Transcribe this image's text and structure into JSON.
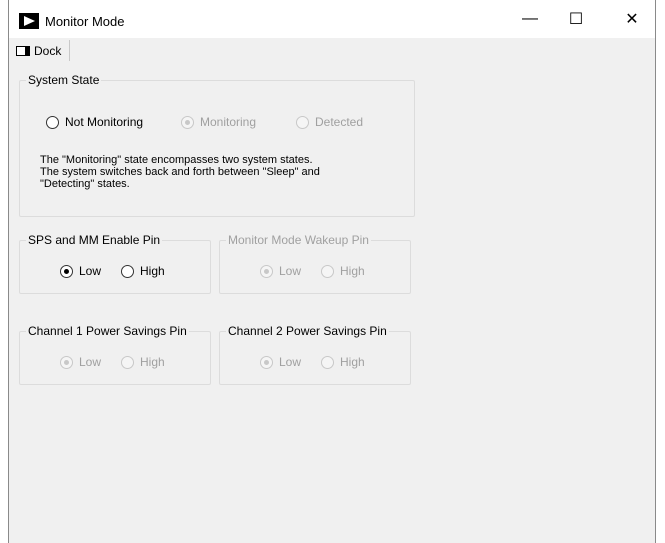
{
  "window": {
    "title": "Monitor Mode",
    "minimize_glyph": "—",
    "maximize_glyph": "☐",
    "close_glyph": "✕"
  },
  "toolbar": {
    "dock_label": "Dock"
  },
  "system_state": {
    "legend": "System State",
    "options": [
      {
        "label": "Not Monitoring",
        "checked": false,
        "enabled": true
      },
      {
        "label": "Monitoring",
        "checked": true,
        "enabled": false
      },
      {
        "label": "Detected",
        "checked": false,
        "enabled": false
      }
    ],
    "description": [
      "The \"Monitoring\" state encompasses two system states.",
      "The system switches back and forth between \"Sleep\" and",
      "\"Detecting\" states."
    ]
  },
  "sps_pin": {
    "legend": "SPS and MM Enable Pin",
    "low_label": "Low",
    "high_label": "High",
    "selected": "Low",
    "enabled": true
  },
  "wakeup_pin": {
    "legend": "Monitor Mode Wakeup Pin",
    "low_label": "Low",
    "high_label": "High",
    "selected": "Low",
    "enabled": false
  },
  "ch1_pin": {
    "legend": "Channel 1 Power Savings Pin",
    "low_label": "Low",
    "high_label": "High",
    "selected": "Low",
    "enabled": false
  },
  "ch2_pin": {
    "legend": "Channel 2 Power Savings Pin",
    "low_label": "Low",
    "high_label": "High",
    "selected": "Low",
    "enabled": false
  }
}
